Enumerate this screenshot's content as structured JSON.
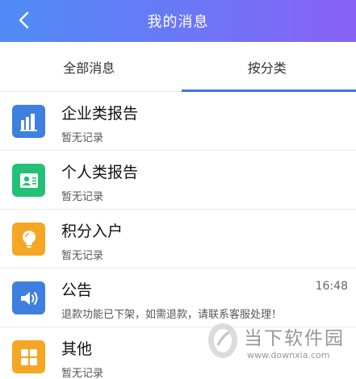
{
  "header": {
    "title": "我的消息",
    "back_icon": "chevron-left-icon"
  },
  "tabs": [
    {
      "label": "全部消息",
      "active": false
    },
    {
      "label": "按分类",
      "active": true
    }
  ],
  "accent_color": "#3f73e6",
  "items": [
    {
      "title": "企业类报告",
      "subtitle": "暂无记录",
      "time": "",
      "icon": "building-icon",
      "color": "#3f7fe0"
    },
    {
      "title": "个人类报告",
      "subtitle": "暂无记录",
      "time": "",
      "icon": "contact-card-icon",
      "color": "#23c178"
    },
    {
      "title": "积分入户",
      "subtitle": "暂无记录",
      "time": "",
      "icon": "lightbulb-icon",
      "color": "#f5a623"
    },
    {
      "title": "公告",
      "subtitle": "退款功能已下架，如需退款，请联系客服处理！",
      "time": "16:48",
      "icon": "speaker-icon",
      "color": "#3f7fe0"
    },
    {
      "title": "其他",
      "subtitle": "暂无记录",
      "time": "",
      "icon": "grid-icon",
      "color": "#f5a623"
    }
  ],
  "watermark": {
    "text": "当下软件园",
    "url": "www.downxia.com"
  }
}
